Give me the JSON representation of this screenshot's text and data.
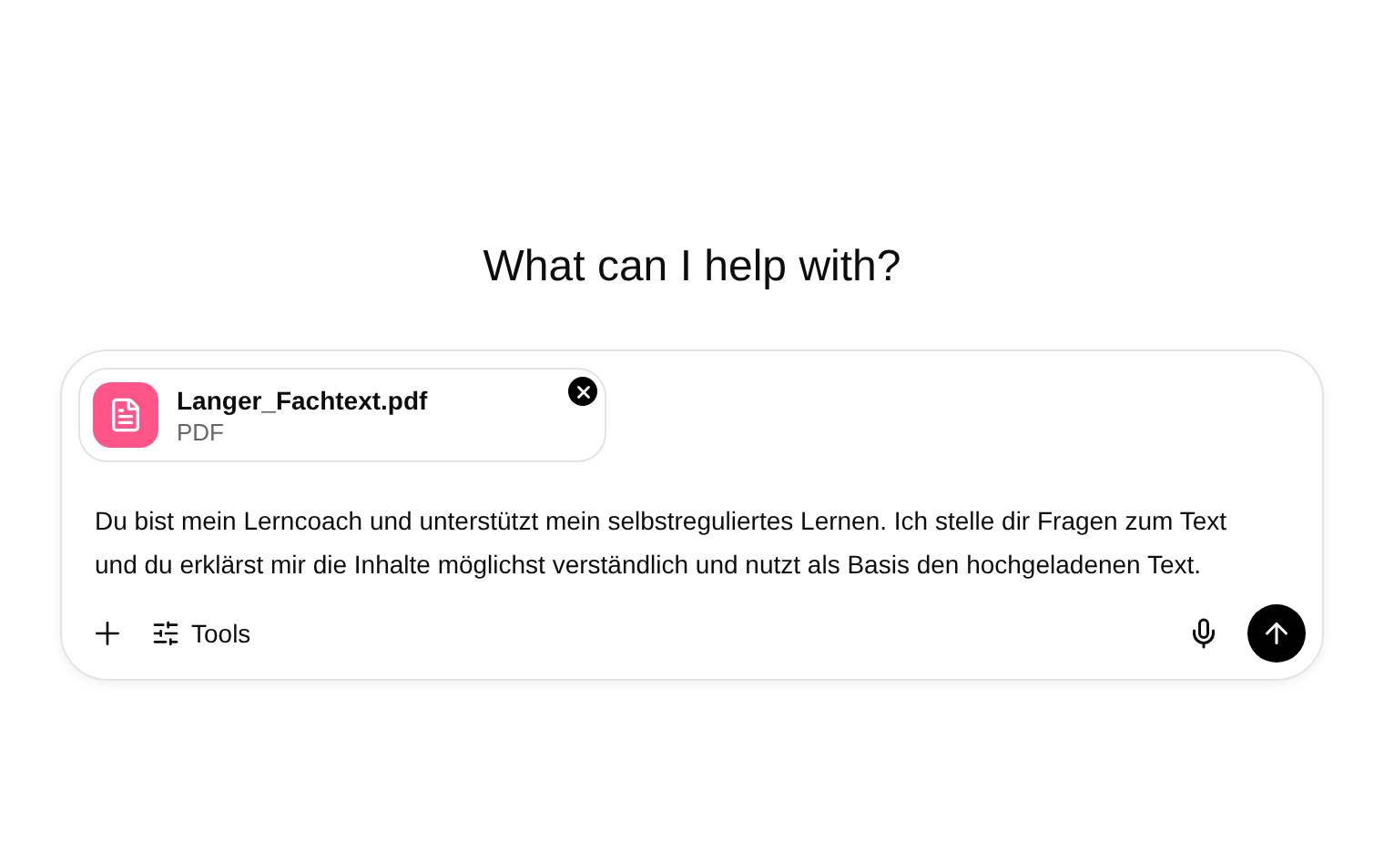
{
  "heading": "What can I help with?",
  "attachment": {
    "name": "Langer_Fachtext.pdf",
    "type": "PDF"
  },
  "prompt": {
    "value": "Du bist mein Lerncoach und unterstützt mein selbstreguliertes Lernen. Ich stelle dir Fragen zum Text und du erklärst mir die Inhalte möglichst verständlich und nutzt als Basis den hochgeladenen Text."
  },
  "toolbar": {
    "tools_label": "Tools"
  }
}
